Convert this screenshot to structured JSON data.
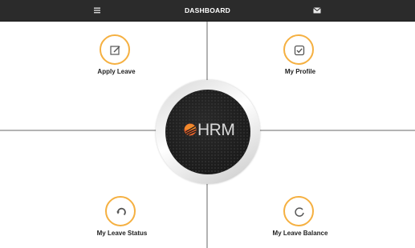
{
  "header": {
    "title": "DASHBOARD"
  },
  "icons": {
    "menu": "hamburger-menu-icon",
    "mail": "envelope-icon"
  },
  "center_logo": {
    "text": "HRM"
  },
  "tiles": [
    {
      "label": "Apply Leave",
      "icon": "edit-icon"
    },
    {
      "label": "My Profile",
      "icon": "checkbox-icon"
    },
    {
      "label": "My Leave Status",
      "icon": "refresh-icon"
    },
    {
      "label": "My Leave Balance",
      "icon": "progress-icon"
    }
  ],
  "colors": {
    "accent": "#f5b041",
    "topbar": "#2b2b2b",
    "divider": "#b3b3b3"
  }
}
